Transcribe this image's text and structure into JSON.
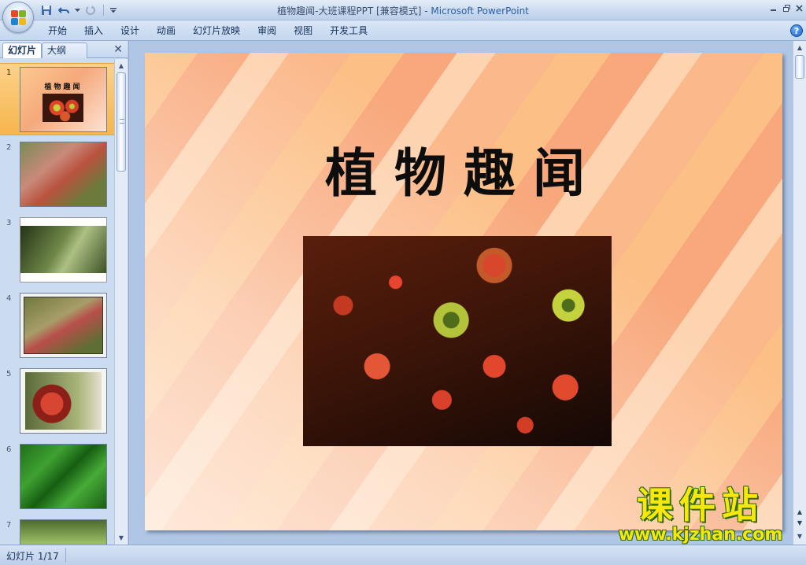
{
  "window": {
    "title": "植物趣闻-大班课程PPT [兼容模式]",
    "title_sep": " - ",
    "app_name": "Microsoft PowerPoint"
  },
  "quick_access": [
    "save-icon",
    "undo-icon",
    "redo-icon",
    "customize-icon"
  ],
  "ribbon": {
    "tabs": [
      "开始",
      "插入",
      "设计",
      "动画",
      "幻灯片放映",
      "审阅",
      "视图",
      "开发工具"
    ],
    "help_label": "?"
  },
  "left_panel": {
    "tabs": [
      "幻灯片",
      "大纲"
    ],
    "close_label": "✕",
    "slides": [
      {
        "num": "1",
        "title": "植物趣闻",
        "selected": true
      },
      {
        "num": "2"
      },
      {
        "num": "3"
      },
      {
        "num": "4"
      },
      {
        "num": "5"
      },
      {
        "num": "6"
      },
      {
        "num": "7"
      }
    ]
  },
  "slide": {
    "title": "植物趣闻"
  },
  "watermark": {
    "text": "课件站",
    "url": "www.kjzhan.com"
  },
  "status": {
    "slide_info": "幻灯片 1/17"
  },
  "colors": {
    "accent": "#2a5fa8",
    "selection": "#f7b54d",
    "ribbon_bg": "#c4d7ef",
    "watermark": "#f6e70d"
  }
}
